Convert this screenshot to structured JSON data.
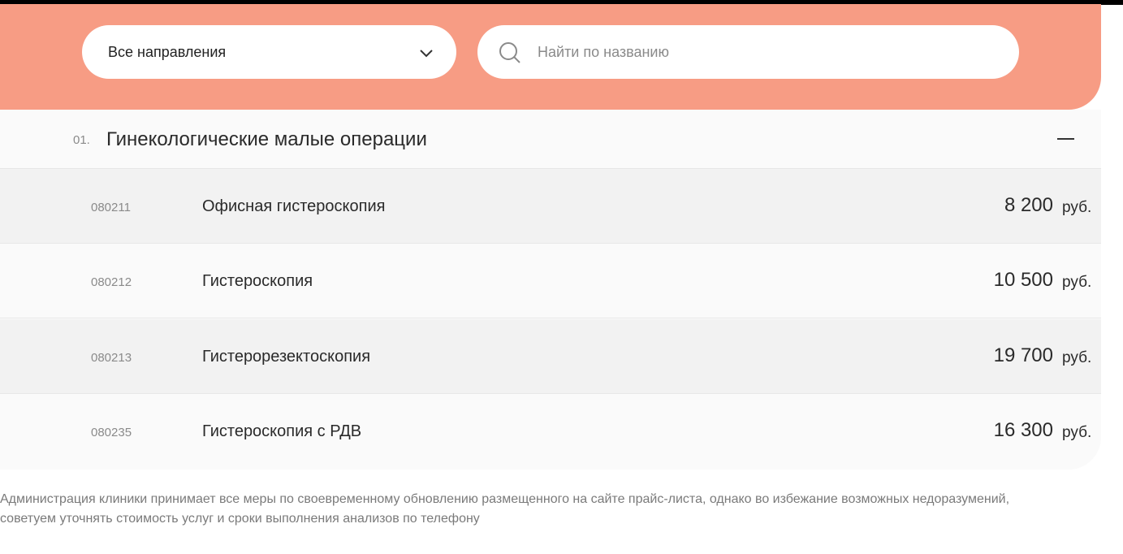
{
  "colors": {
    "accent": "#f79c84",
    "card_bg": "#fafafa",
    "row_alt_bg": "#f2f2f2",
    "text": "#2a2a2a",
    "muted": "#8a8a8a"
  },
  "filters": {
    "direction_select": {
      "value": "Все направления",
      "icon": "chevron-down-icon"
    },
    "search": {
      "placeholder": "Найти по названию",
      "icon": "search-icon"
    }
  },
  "category": {
    "number": "01.",
    "title": "Гинекологические малые операции",
    "toggle_icon": "minus-icon"
  },
  "services": [
    {
      "code": "080211",
      "name": "Офисная гистероскопия",
      "price": "8 200",
      "currency": "руб."
    },
    {
      "code": "080212",
      "name": "Гистероскопия",
      "price": "10 500",
      "currency": "руб."
    },
    {
      "code": "080213",
      "name": "Гистерорезектоскопия",
      "price": "19 700",
      "currency": "руб."
    },
    {
      "code": "080235",
      "name": "Гистероскопия с РДВ",
      "price": "16 300",
      "currency": "руб."
    }
  ],
  "disclaimer": "Администрация клиники принимает все меры по своевременному обновлению размещенного на сайте прайс-листа, однако во избежание возможных недоразумений, советуем уточнять стоимость услуг и сроки выполнения анализов по телефону"
}
